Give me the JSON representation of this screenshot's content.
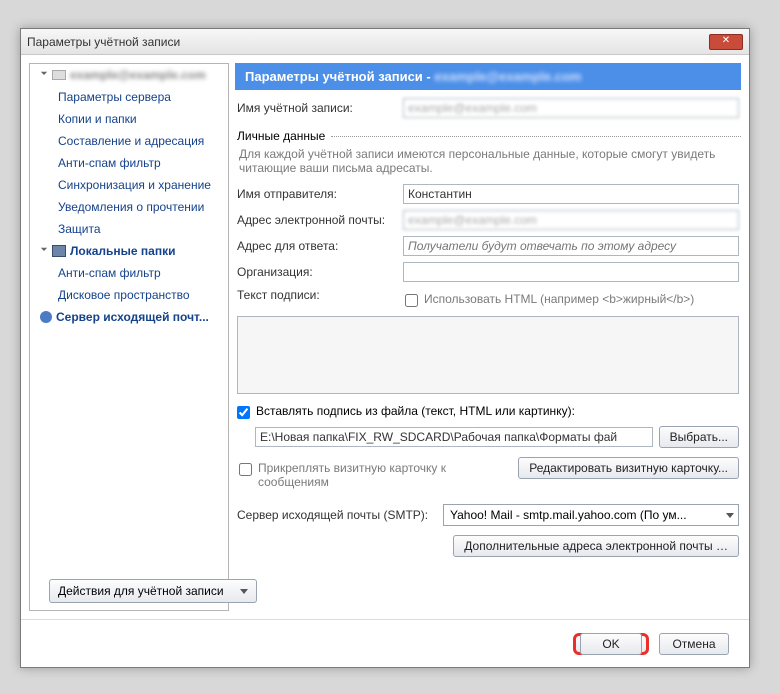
{
  "window": {
    "title": "Параметры учётной записи"
  },
  "tree": {
    "account_email": "example@example.com",
    "items": [
      "Параметры сервера",
      "Копии и папки",
      "Составление и адресация",
      "Анти-спам фильтр",
      "Синхронизация и хранение",
      "Уведомления о прочтении",
      "Защита"
    ],
    "local_folders": "Локальные папки",
    "local_items": [
      "Анти-спам фильтр",
      "Дисковое пространство"
    ],
    "smtp": "Сервер исходящей почт..."
  },
  "header": {
    "prefix": "Параметры учётной записи -",
    "blurred": "example@example.com"
  },
  "acct_name": {
    "label": "Имя учётной записи:",
    "value": "example@example.com"
  },
  "personal_section": "Личные данные",
  "personal_desc": "Для каждой учётной записи имеются персональные данные, которые смогут увидеть читающие ваши письма адресаты.",
  "fields": {
    "sender_label": "Имя отправителя:",
    "sender_value": "Константин",
    "email_label": "Адрес электронной почты:",
    "email_value": "example@example.com",
    "reply_label": "Адрес для ответа:",
    "reply_placeholder": "Получатели будут отвечать по этому адресу",
    "org_label": "Организация:",
    "org_value": "",
    "sig_label": "Текст подписи:",
    "html_checkbox": "Использовать HTML (например <b>жирный</b>)",
    "attach_sig": "Вставлять подпись из файла (текст, HTML или картинку):",
    "sig_file_value": "E:\\Новая папка\\FIX_RW_SDCARD\\Рабочая папка\\Форматы фай",
    "browse_btn": "Выбрать...",
    "vcard_checkbox": "Прикреплять визитную карточку к сообщениям",
    "vcard_btn": "Редактировать визитную карточку...",
    "smtp_label": "Сервер исходящей почты (SMTP):",
    "smtp_value": "Yahoo! Mail - smtp.mail.yahoo.com (По ум...",
    "additional_btn": "Дополнительные адреса электронной почты …"
  },
  "actions_dropdown": "Действия для учётной записи",
  "buttons": {
    "ok": "OK",
    "cancel": "Отмена"
  }
}
